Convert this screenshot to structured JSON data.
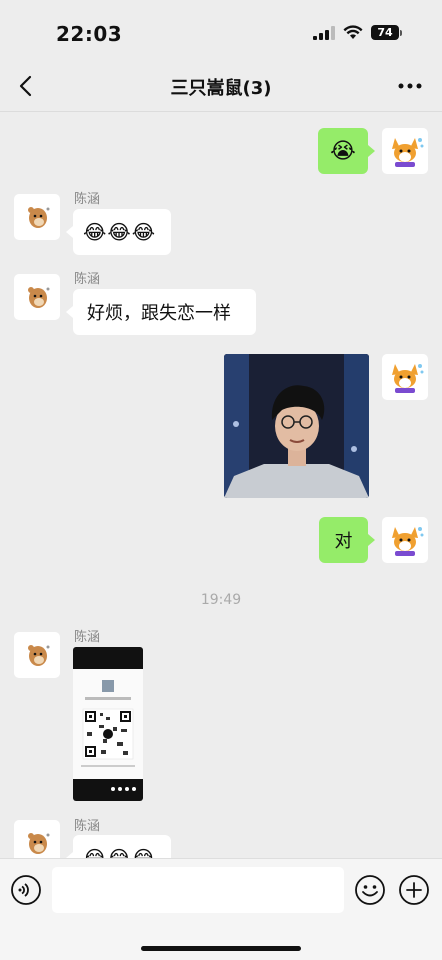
{
  "status_bar": {
    "time": "22:03",
    "battery": "74"
  },
  "header": {
    "title": "三只嵩鼠(3)"
  },
  "messages": [
    {
      "dir": "out",
      "kind": "emoji",
      "content": "😭"
    },
    {
      "dir": "in",
      "sender": "陈涵",
      "kind": "emoji",
      "content": "😂😂😂"
    },
    {
      "dir": "in",
      "sender": "陈涵",
      "kind": "text",
      "content": "好烦，跟失恋一样"
    },
    {
      "dir": "out",
      "kind": "image",
      "content": "photo"
    },
    {
      "dir": "out",
      "kind": "text",
      "content": "对"
    },
    {
      "dir": "in",
      "sender": "陈涵",
      "kind": "image",
      "content": "qr-screenshot"
    },
    {
      "dir": "in",
      "sender": "陈涵",
      "kind": "emoji",
      "content": "😂😂😂"
    }
  ],
  "timestamp": "19:49",
  "icons": {
    "back": "chevron-left-icon",
    "more": "more-dots-icon",
    "voice": "voice-icon",
    "emoji": "emoji-face-icon",
    "plus": "plus-icon"
  },
  "colors": {
    "background": "#ededed",
    "outgoing_bubble": "#95ec69",
    "incoming_bubble": "#ffffff"
  }
}
